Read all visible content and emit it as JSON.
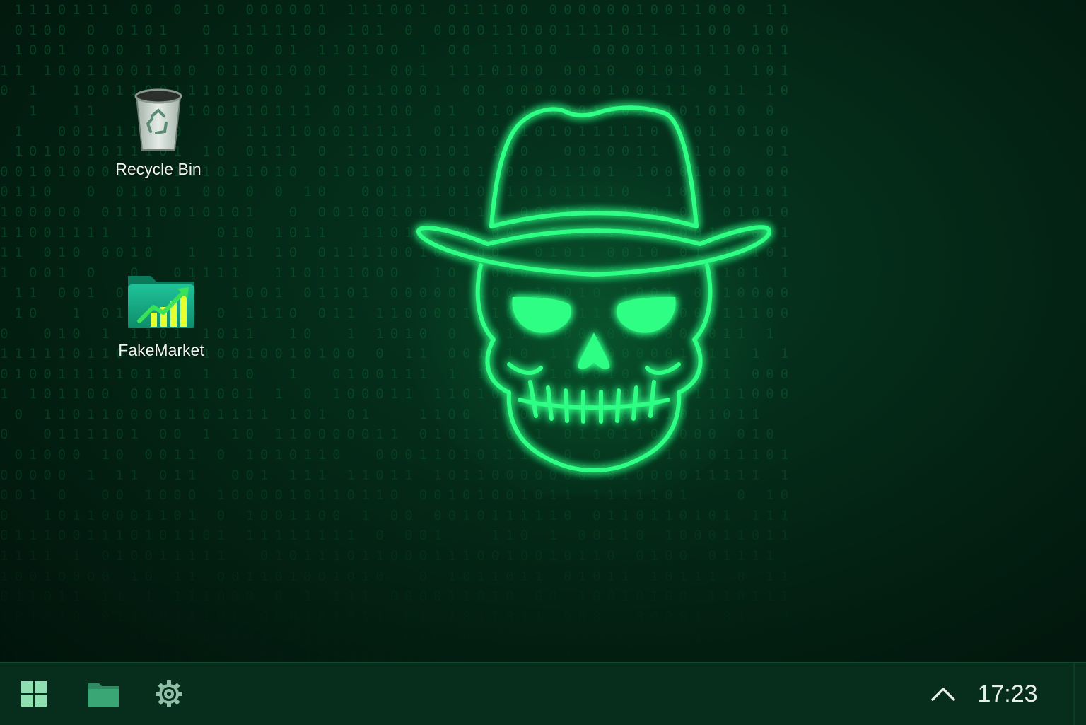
{
  "desktop": {
    "icons": [
      {
        "label": "Recycle Bin",
        "icon": "recycle-bin-icon"
      },
      {
        "label": "FakeMarket",
        "icon": "stock-chart-folder-icon"
      }
    ],
    "wallpaper": {
      "subject": "skull-with-fedora-icon",
      "background_pattern": "binary-code",
      "glow_color": "#2dff84"
    }
  },
  "taskbar": {
    "buttons": [
      {
        "icon": "windows-start-icon"
      },
      {
        "icon": "folder-icon"
      },
      {
        "icon": "gear-icon"
      }
    ],
    "tray_icon": "chevron-up-icon",
    "clock": "17:23"
  },
  "colors": {
    "accent": "#2dff84",
    "taskbar": "#072d1c",
    "background": "#021a10"
  }
}
